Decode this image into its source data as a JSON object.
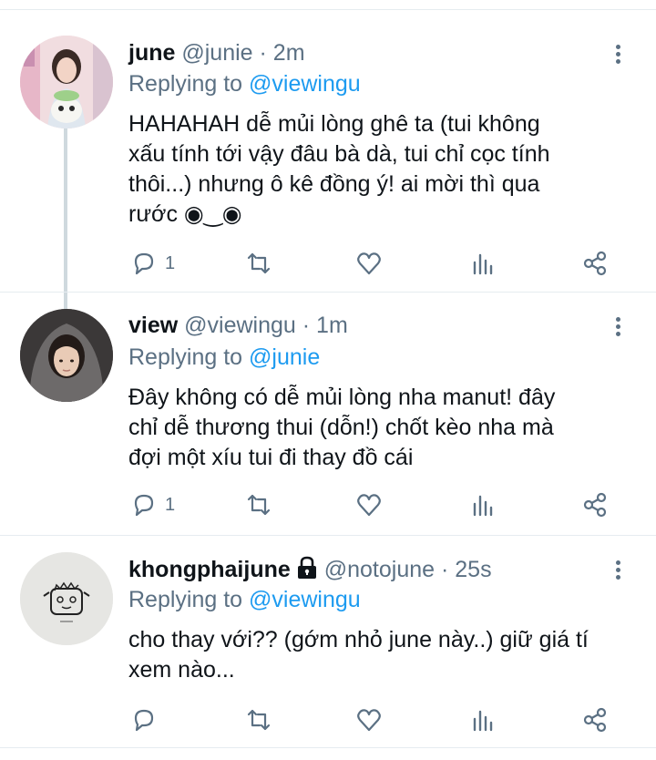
{
  "tweets": [
    {
      "name": "june",
      "handle": "@junie",
      "time": "2m",
      "replying_label": "Replying to",
      "replying_to": "@viewingu",
      "body_lines": [
        "HAHAHAH dễ mủi lòng ghê ta (tui không",
        "xấu tính tới vậy đâu bà dà, tui chỉ cọc tính",
        "thôi...) nhưng ô kê đồng ý! ai mời thì qua",
        "rước ◉‿◉"
      ],
      "reply_count": "1",
      "locked": false
    },
    {
      "name": "view",
      "handle": "@viewingu",
      "time": "1m",
      "replying_label": "Replying to",
      "replying_to": "@junie",
      "body_lines": [
        "Đây không có dễ mủi lòng nha manut! đây",
        "chỉ dễ thương thui (dỗn!) chốt kèo nha mà",
        "đợi một xíu tui đi thay đồ cái"
      ],
      "reply_count": "1",
      "locked": false
    },
    {
      "name": "khongphaijune",
      "handle": "@notojune",
      "time": "25s",
      "replying_label": "Replying to",
      "replying_to": "@viewingu",
      "body_lines": [
        "cho thay với?? (gớm nhỏ june này..) giữ giá tí",
        "xem nào..."
      ],
      "reply_count": "",
      "locked": true
    }
  ],
  "separator": "·",
  "icons": [
    "reply-icon",
    "retweet-icon",
    "like-icon",
    "analytics-icon",
    "share-icon",
    "more-icon",
    "lock-icon"
  ],
  "colors": {
    "accent": "#1d9bf0",
    "muted": "#5b7083",
    "text": "#0f1419",
    "line": "#cfd9de"
  }
}
